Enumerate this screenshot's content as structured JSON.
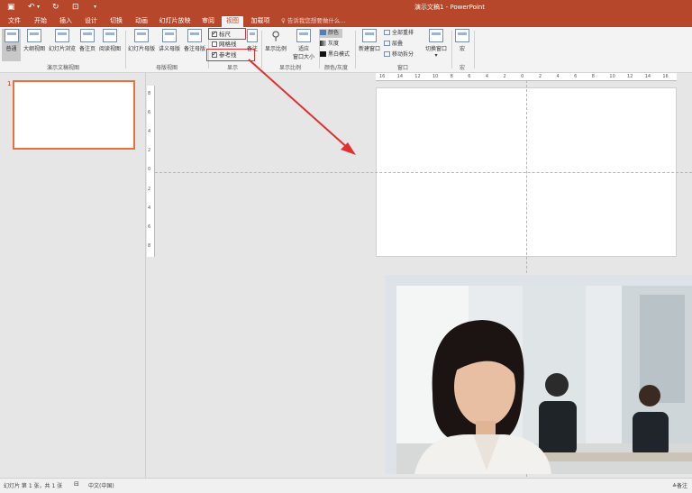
{
  "window": {
    "title": "演示文稿1 - PowerPoint"
  },
  "quick_access": {
    "save_icon": "save-icon",
    "undo_icon": "undo-icon",
    "redo_icon": "redo-icon",
    "start_icon": "start-from-beginning-icon",
    "more_icon": "customize-icon"
  },
  "tabs": [
    {
      "label": "文件"
    },
    {
      "label": "开始"
    },
    {
      "label": "插入"
    },
    {
      "label": "设计"
    },
    {
      "label": "切换"
    },
    {
      "label": "动画"
    },
    {
      "label": "幻灯片放映"
    },
    {
      "label": "审阅"
    },
    {
      "label": "视图",
      "active": true
    },
    {
      "label": "加载项"
    }
  ],
  "search": {
    "placeholder": "告诉我您想要做什么..."
  },
  "ribbon": {
    "presentation_views": {
      "label": "演示文稿视图",
      "buttons": [
        "普通",
        "大纲视图",
        "幻灯片浏览",
        "备注页",
        "阅读视图"
      ]
    },
    "master_views": {
      "label": "母版视图",
      "buttons": [
        "幻灯片母版",
        "讲义母版",
        "备注母版"
      ]
    },
    "show": {
      "label": "显示",
      "ruler": {
        "label": "标尺",
        "checked": true
      },
      "gridlines": {
        "label": "网格线",
        "checked": false
      },
      "guides": {
        "label": "参考线",
        "checked": true
      },
      "notes": "备注"
    },
    "zoom": {
      "label": "显示比例",
      "buttons": [
        "显示比例",
        "适应",
        "窗口大小"
      ]
    },
    "color": {
      "label": "颜色/灰度",
      "options": [
        "颜色",
        "灰度",
        "黑白模式"
      ]
    },
    "window": {
      "label": "窗口",
      "new_window": "新建窗口",
      "options": [
        "全部重排",
        "层叠",
        "移动拆分"
      ],
      "switch": "切换窗口"
    },
    "macro": {
      "label": "宏",
      "button": "宏"
    }
  },
  "thumbnails": {
    "slide_number": "1"
  },
  "ruler": {
    "h_ticks": [
      "16",
      "14",
      "12",
      "10",
      "8",
      "6",
      "4",
      "2",
      "0",
      "2",
      "4",
      "6",
      "8",
      "10",
      "12",
      "14",
      "16"
    ],
    "v_ticks": [
      "8",
      "6",
      "4",
      "2",
      "0",
      "2",
      "4",
      "6",
      "8"
    ]
  },
  "statusbar": {
    "slide_info": "幻灯片 第 1 张，共 1 张",
    "language": "中文(中国)",
    "notes": "备注"
  },
  "colors": {
    "accent": "#b7472a",
    "highlight": "#e03131",
    "thumb_border": "#e9703e"
  }
}
